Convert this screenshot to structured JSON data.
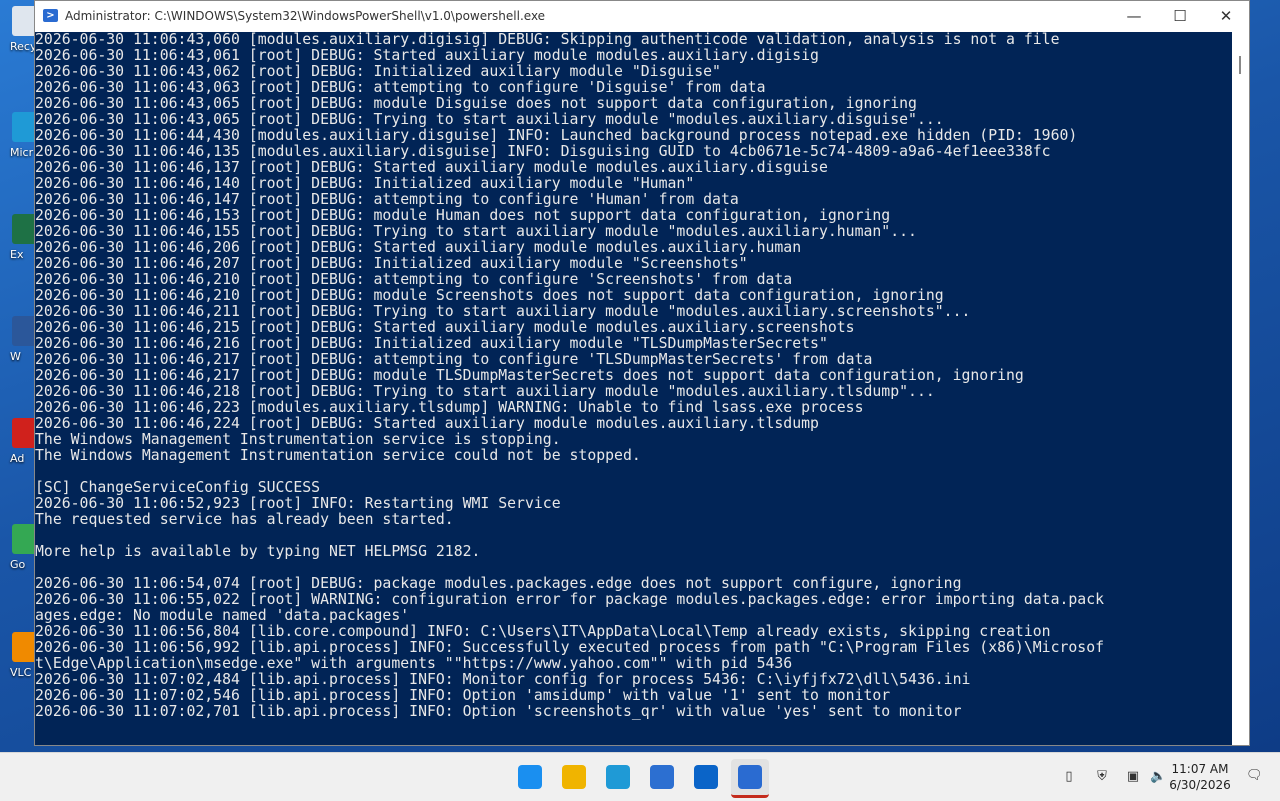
{
  "window": {
    "title": "Administrator: C:\\WINDOWS\\System32\\WindowsPowerShell\\v1.0\\powershell.exe",
    "icon": "powershell-icon",
    "controls": {
      "minimize": "—",
      "maximize": "☐",
      "close": "✕"
    }
  },
  "desktop": {
    "icons": [
      {
        "name": "recycle-bin-icon",
        "label": "Recy",
        "color": "#dfe6ee"
      },
      {
        "name": "edge-desktop-icon",
        "label": "Micr",
        "color": "#1f9ad6"
      },
      {
        "name": "excel-desktop-icon",
        "label": "Ex",
        "color": "#1e7145"
      },
      {
        "name": "word-desktop-icon",
        "label": "W",
        "color": "#2b579a"
      },
      {
        "name": "acrobat-desktop-icon",
        "label": "Ad",
        "color": "#d0211c"
      },
      {
        "name": "chrome-desktop-icon",
        "label": "Go",
        "color": "#34a853"
      },
      {
        "name": "vlc-desktop-icon",
        "label": "VLC",
        "color": "#f08a00"
      }
    ]
  },
  "console": {
    "background": "#012456",
    "lines": [
      "2026-06-30 11:06:43,060 [modules.auxiliary.digisig] DEBUG: Skipping authenticode validation, analysis is not a file",
      "2026-06-30 11:06:43,061 [root] DEBUG: Started auxiliary module modules.auxiliary.digisig",
      "2026-06-30 11:06:43,062 [root] DEBUG: Initialized auxiliary module \"Disguise\"",
      "2026-06-30 11:06:43,063 [root] DEBUG: attempting to configure 'Disguise' from data",
      "2026-06-30 11:06:43,065 [root] DEBUG: module Disguise does not support data configuration, ignoring",
      "2026-06-30 11:06:43,065 [root] DEBUG: Trying to start auxiliary module \"modules.auxiliary.disguise\"...",
      "2026-06-30 11:06:44,430 [modules.auxiliary.disguise] INFO: Launched background process notepad.exe hidden (PID: 1960)",
      "2026-06-30 11:06:46,135 [modules.auxiliary.disguise] INFO: Disguising GUID to 4cb0671e-5c74-4809-a9a6-4ef1eee338fc",
      "2026-06-30 11:06:46,137 [root] DEBUG: Started auxiliary module modules.auxiliary.disguise",
      "2026-06-30 11:06:46,140 [root] DEBUG: Initialized auxiliary module \"Human\"",
      "2026-06-30 11:06:46,147 [root] DEBUG: attempting to configure 'Human' from data",
      "2026-06-30 11:06:46,153 [root] DEBUG: module Human does not support data configuration, ignoring",
      "2026-06-30 11:06:46,155 [root] DEBUG: Trying to start auxiliary module \"modules.auxiliary.human\"...",
      "2026-06-30 11:06:46,206 [root] DEBUG: Started auxiliary module modules.auxiliary.human",
      "2026-06-30 11:06:46,207 [root] DEBUG: Initialized auxiliary module \"Screenshots\"",
      "2026-06-30 11:06:46,210 [root] DEBUG: attempting to configure 'Screenshots' from data",
      "2026-06-30 11:06:46,210 [root] DEBUG: module Screenshots does not support data configuration, ignoring",
      "2026-06-30 11:06:46,211 [root] DEBUG: Trying to start auxiliary module \"modules.auxiliary.screenshots\"...",
      "2026-06-30 11:06:46,215 [root] DEBUG: Started auxiliary module modules.auxiliary.screenshots",
      "2026-06-30 11:06:46,216 [root] DEBUG: Initialized auxiliary module \"TLSDumpMasterSecrets\"",
      "2026-06-30 11:06:46,217 [root] DEBUG: attempting to configure 'TLSDumpMasterSecrets' from data",
      "2026-06-30 11:06:46,217 [root] DEBUG: module TLSDumpMasterSecrets does not support data configuration, ignoring",
      "2026-06-30 11:06:46,218 [root] DEBUG: Trying to start auxiliary module \"modules.auxiliary.tlsdump\"...",
      "2026-06-30 11:06:46,223 [modules.auxiliary.tlsdump] WARNING: Unable to find lsass.exe process",
      "2026-06-30 11:06:46,224 [root] DEBUG: Started auxiliary module modules.auxiliary.tlsdump",
      "The Windows Management Instrumentation service is stopping.",
      "The Windows Management Instrumentation service could not be stopped.",
      "",
      "[SC] ChangeServiceConfig SUCCESS",
      "2026-06-30 11:06:52,923 [root] INFO: Restarting WMI Service",
      "The requested service has already been started.",
      "",
      "More help is available by typing NET HELPMSG 2182.",
      "",
      "2026-06-30 11:06:54,074 [root] DEBUG: package modules.packages.edge does not support configure, ignoring",
      "2026-06-30 11:06:55,022 [root] WARNING: configuration error for package modules.packages.edge: error importing data.pack",
      "ages.edge: No module named 'data.packages'",
      "2026-06-30 11:06:56,804 [lib.core.compound] INFO: C:\\Users\\IT\\AppData\\Local\\Temp already exists, skipping creation",
      "2026-06-30 11:06:56,992 [lib.api.process] INFO: Successfully executed process from path \"C:\\Program Files (x86)\\Microsof",
      "t\\Edge\\Application\\msedge.exe\" with arguments \"\"https://www.yahoo.com\"\" with pid 5436",
      "2026-06-30 11:07:02,484 [lib.api.process] INFO: Monitor config for process 5436: C:\\iyfjfx72\\dll\\5436.ini",
      "2026-06-30 11:07:02,546 [lib.api.process] INFO: Option 'amsidump' with value '1' sent to monitor",
      "2026-06-30 11:07:02,701 [lib.api.process] INFO: Option 'screenshots_qr' with value 'yes' sent to monitor"
    ]
  },
  "taskbar": {
    "apps": [
      {
        "name": "start-button",
        "icon": "windows-start-icon",
        "color": "#1a8ff0"
      },
      {
        "name": "file-explorer-button",
        "icon": "folder-icon",
        "color": "#f0b400"
      },
      {
        "name": "edge-button",
        "icon": "edge-icon",
        "color": "#1f9ad6"
      },
      {
        "name": "store-button",
        "icon": "store-icon",
        "color": "#2c6fd1"
      },
      {
        "name": "outlook-button",
        "icon": "outlook-icon",
        "color": "#0a64c8"
      },
      {
        "name": "powershell-button",
        "icon": "powershell-icon",
        "color": "#2a6bd1",
        "active": true
      }
    ],
    "tray": [
      {
        "name": "usb-icon",
        "glyph": "▯"
      },
      {
        "name": "security-icon",
        "glyph": "⛨"
      },
      {
        "name": "network-icon",
        "glyph": "▣"
      },
      {
        "name": "volume-muted-icon",
        "glyph": "🔈"
      }
    ],
    "clock": {
      "time": "11:07 AM",
      "date": "6/30/2026"
    },
    "notification_icon": "notification-icon"
  }
}
